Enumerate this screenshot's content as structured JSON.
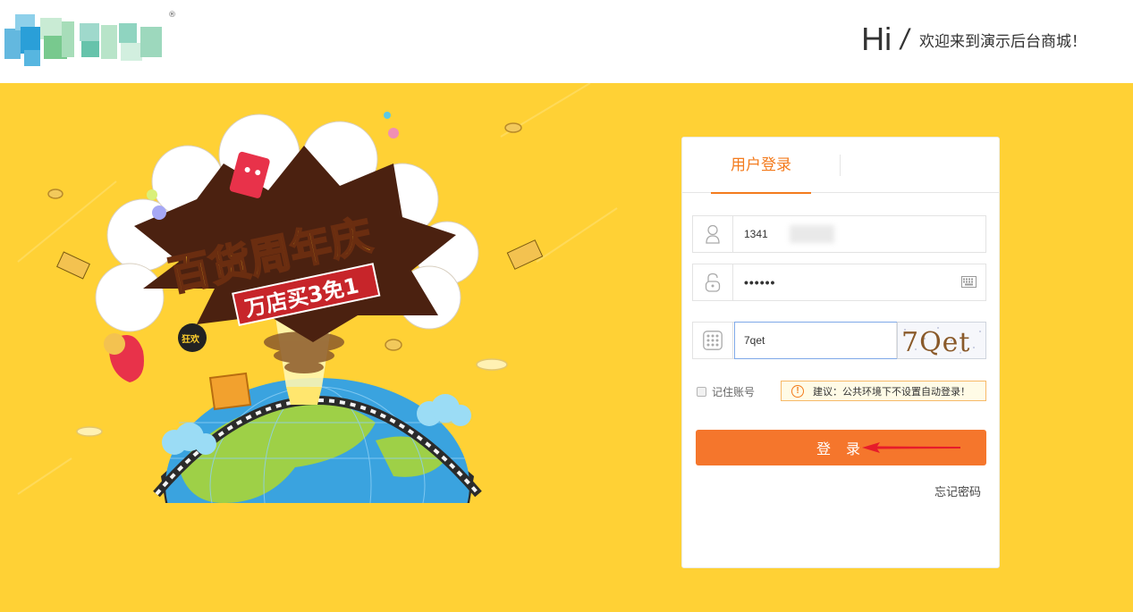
{
  "header": {
    "logo_reg_mark": "®",
    "greeting_hi": "Hi",
    "greeting_slash": "/",
    "greeting_text": "欢迎来到演示后台商城！"
  },
  "banner": {
    "background_color": "#ffd135",
    "illustration": {
      "title": "百货周年庆",
      "subtitle": "万店买3免1",
      "badge": "狂欢"
    }
  },
  "login": {
    "tab_label": "用户登录",
    "username_value": "1341",
    "password_value": "••••••",
    "captcha_value": "7qet",
    "captcha_image_text": "7Qet",
    "remember_label": "记住账号",
    "tip_text": "建议：公共环境下不设置自动登录！",
    "login_button": "登 录",
    "forgot_link": "忘记密码",
    "accent_color": "#f5762c"
  },
  "icons": {
    "user": "user-icon",
    "lock": "lock-icon",
    "keyboard": "keyboard-icon",
    "captcha": "grid-icon",
    "warning": "warning-icon",
    "arrow": "arrow-left-icon"
  }
}
